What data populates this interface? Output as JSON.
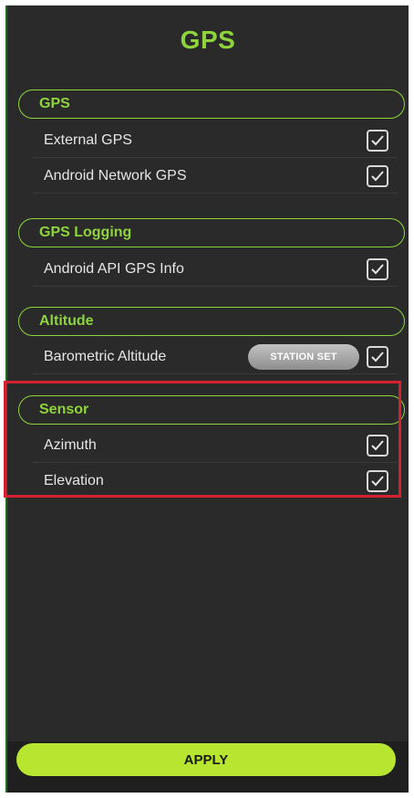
{
  "screen": {
    "title": "GPS"
  },
  "sections": {
    "gps": {
      "header": "GPS",
      "items": [
        {
          "label": "External GPS",
          "checked": true
        },
        {
          "label": "Android Network GPS",
          "checked": true
        }
      ]
    },
    "gps_logging": {
      "header": "GPS Logging",
      "items": [
        {
          "label": "Android API GPS Info",
          "checked": true
        }
      ]
    },
    "altitude": {
      "header": "Altitude",
      "items": [
        {
          "label": "Barometric Altitude",
          "checked": true,
          "button_label": "STATION SET"
        }
      ]
    },
    "sensor": {
      "header": "Sensor",
      "items": [
        {
          "label": "Azimuth",
          "checked": true
        },
        {
          "label": "Elevation",
          "checked": true
        }
      ]
    }
  },
  "footer": {
    "apply_label": "APPLY"
  },
  "colors": {
    "accent": "#8fd43c",
    "apply_button": "#b8e630",
    "highlight": "#d62030",
    "background": "#2a2a2a"
  },
  "icons": {
    "checkbox": "checkmark-icon"
  }
}
